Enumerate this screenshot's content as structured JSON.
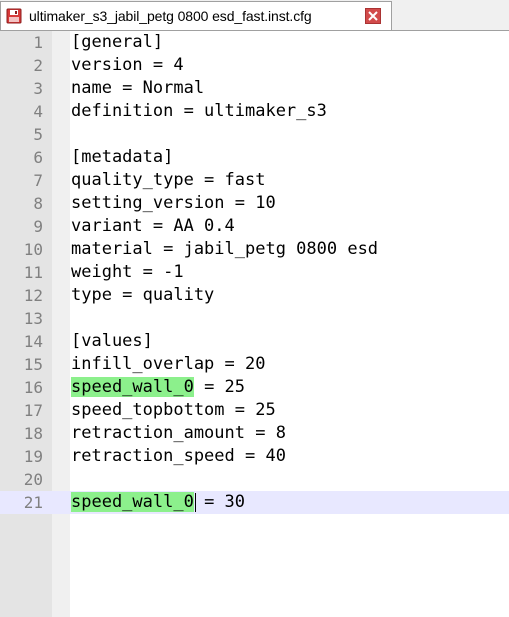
{
  "tab": {
    "filename": "ultimaker_s3_jabil_petg 0800 esd_fast.inst.cfg",
    "icon": "floppy-disk-red-icon",
    "close_icon": "close-icon"
  },
  "colors": {
    "highlight": "#8cf08c",
    "current_line": "#e8e8ff",
    "gutter": "#e4e4e4",
    "line_number": "#808080"
  },
  "lines": [
    {
      "num": "1",
      "pre": "[general]",
      "hl": "",
      "post": ""
    },
    {
      "num": "2",
      "pre": "version = 4",
      "hl": "",
      "post": ""
    },
    {
      "num": "3",
      "pre": "name = Normal",
      "hl": "",
      "post": ""
    },
    {
      "num": "4",
      "pre": "definition = ultimaker_s3",
      "hl": "",
      "post": ""
    },
    {
      "num": "5",
      "pre": "",
      "hl": "",
      "post": ""
    },
    {
      "num": "6",
      "pre": "[metadata]",
      "hl": "",
      "post": ""
    },
    {
      "num": "7",
      "pre": "quality_type = fast",
      "hl": "",
      "post": ""
    },
    {
      "num": "8",
      "pre": "setting_version = 10",
      "hl": "",
      "post": ""
    },
    {
      "num": "9",
      "pre": "variant = AA 0.4",
      "hl": "",
      "post": ""
    },
    {
      "num": "10",
      "pre": "material = jabil_petg 0800 esd",
      "hl": "",
      "post": ""
    },
    {
      "num": "11",
      "pre": "weight = -1",
      "hl": "",
      "post": ""
    },
    {
      "num": "12",
      "pre": "type = quality",
      "hl": "",
      "post": ""
    },
    {
      "num": "13",
      "pre": "",
      "hl": "",
      "post": ""
    },
    {
      "num": "14",
      "pre": "[values]",
      "hl": "",
      "post": ""
    },
    {
      "num": "15",
      "pre": "infill_overlap = 20",
      "hl": "",
      "post": ""
    },
    {
      "num": "16",
      "pre": "",
      "hl": "speed_wall_0",
      "post": " = 25"
    },
    {
      "num": "17",
      "pre": "speed_topbottom = 25",
      "hl": "",
      "post": ""
    },
    {
      "num": "18",
      "pre": "retraction_amount = 8",
      "hl": "",
      "post": ""
    },
    {
      "num": "19",
      "pre": "retraction_speed = 40",
      "hl": "",
      "post": ""
    },
    {
      "num": "20",
      "pre": "",
      "hl": "",
      "post": ""
    },
    {
      "num": "21",
      "pre": "",
      "hl": "speed_wall_0",
      "post": " = 30",
      "current": true,
      "caret": true
    }
  ]
}
